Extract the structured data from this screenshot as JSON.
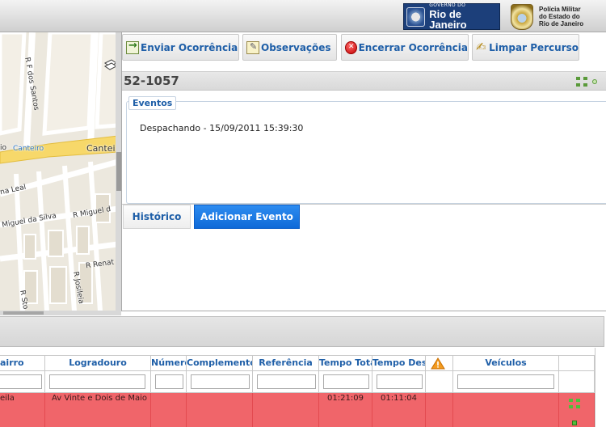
{
  "header": {
    "gov_logo_small": "GOVERNO DO",
    "gov_logo_big": "Rio de Janeiro",
    "pm_logo_line1": "Polícia Militar",
    "pm_logo_line2": "do Estado do",
    "pm_logo_line3": "Rio de Janeiro"
  },
  "map": {
    "labels": {
      "street1": "R F dos Santos",
      "canteiro1": "io",
      "canteiro2": "Canteiro",
      "canteiro3": "Cantei",
      "street2": "na Leal",
      "street3": "Miguel da Silva",
      "street4": "R Miguel d",
      "street5": "R Renat",
      "street6": "R Josileia",
      "street7": "R Sto"
    }
  },
  "toolbar": {
    "send_label": "Enviar Ocorrência",
    "notes_label": "Observações",
    "close_label": "Encerrar Ocorrência",
    "clear_label": "Limpar Percurso"
  },
  "occurrence": {
    "code": "52-1057",
    "events_legend": "Eventos",
    "event_text": "Despachando - 15/09/2011 15:39:30",
    "history_tab": "Histórico",
    "add_event_button": "Adicionar Evento"
  },
  "grid": {
    "columns": [
      "airro",
      "Logradouro",
      "Número",
      "Complemento",
      "Referência",
      "Tempo Tota",
      "Tempo Des",
      "",
      "Veículos",
      ""
    ],
    "row": {
      "bairro": "eila",
      "logradouro": "Av Vinte e Dois de Maio",
      "tempo_total": "01:21:09",
      "tempo_desp": "01:11:04"
    }
  },
  "colors": {
    "accent": "#1f5fa8",
    "primary_button": "#1a7ae0",
    "alert_row": "#f0656a"
  }
}
